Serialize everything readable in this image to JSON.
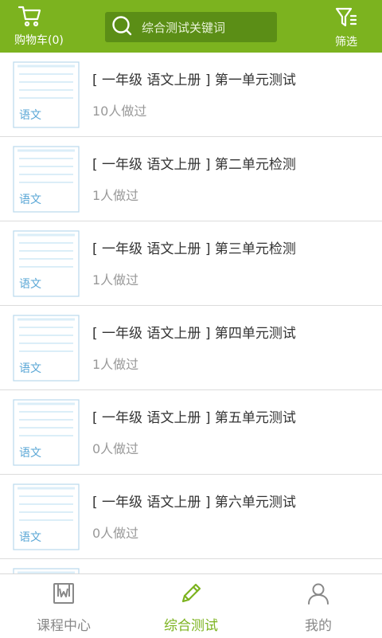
{
  "header": {
    "cart_label": "购物车(0)",
    "search_placeholder": "综合测试关键词",
    "filter_label": "筛选"
  },
  "items": [
    {
      "subject": "语文",
      "title": "[ 一年级 语文上册 ] 第一单元测试",
      "count": "10人做过"
    },
    {
      "subject": "语文",
      "title": "[ 一年级 语文上册 ] 第二单元检测",
      "count": "1人做过"
    },
    {
      "subject": "语文",
      "title": "[ 一年级 语文上册 ] 第三单元检测",
      "count": "1人做过"
    },
    {
      "subject": "语文",
      "title": "[ 一年级 语文上册 ] 第四单元测试",
      "count": "1人做过"
    },
    {
      "subject": "语文",
      "title": "[ 一年级 语文上册 ] 第五单元测试",
      "count": "0人做过"
    },
    {
      "subject": "语文",
      "title": "[ 一年级 语文上册 ] 第六单元测试",
      "count": "0人做过"
    }
  ],
  "tabs": [
    {
      "label": "课程中心",
      "active": false
    },
    {
      "label": "综合测试",
      "active": true
    },
    {
      "label": "我的",
      "active": false
    }
  ],
  "colors": {
    "brand_green": "#7cb31f",
    "thumb_blue": "#5aa7d6",
    "inactive_tab": "#888888"
  }
}
